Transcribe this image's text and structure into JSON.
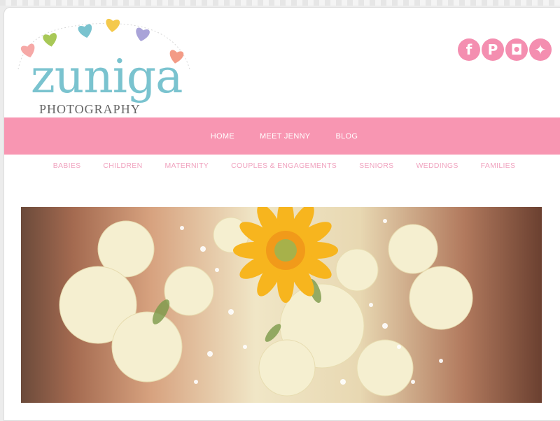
{
  "site": {
    "logo_word": "zuniga",
    "logo_sub": "PHOTOGRAPHY"
  },
  "social": [
    {
      "icon": "facebook-icon",
      "glyph": "f"
    },
    {
      "icon": "pinterest-icon",
      "glyph": "P"
    },
    {
      "icon": "instagram-icon",
      "glyph": "◘"
    },
    {
      "icon": "twitter-icon",
      "glyph": "✦"
    }
  ],
  "nav": {
    "items": [
      "HOME",
      "MEET JENNY",
      "BLOG"
    ]
  },
  "categories": {
    "items": [
      "BABIES",
      "CHILDREN",
      "MATERNITY",
      "COUPLES & ENGAGEMENTS",
      "SENIORS",
      "WEDDINGS",
      "FAMILIES"
    ]
  },
  "colors": {
    "nav_pink": "#f896b2",
    "category_pink": "#f0a3bf",
    "logo_teal": "#7ac3cf",
    "heart_colors": [
      "#f6a9a7",
      "#a8c857",
      "#7ac3cf",
      "#f4c94c",
      "#a9a3d8",
      "#f39b86"
    ]
  }
}
